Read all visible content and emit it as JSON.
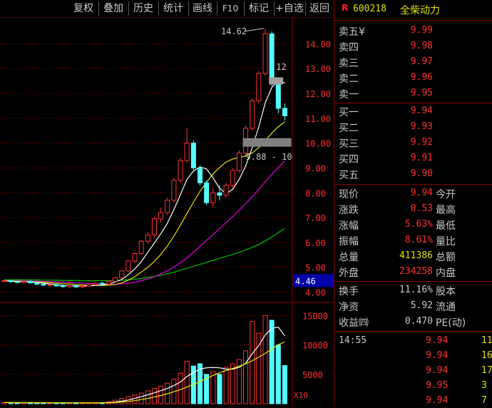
{
  "toolbar": {
    "buttons": [
      "复权",
      "叠加",
      "历史",
      "统计",
      "画线",
      "F10",
      "标记",
      "+自选",
      "返回"
    ]
  },
  "stock": {
    "badge": "R",
    "code": "600218",
    "name": "全柴动力"
  },
  "chart_data": {
    "type": "candlestick",
    "y_axis_labels": [
      "14.00",
      "13.00",
      "12.00",
      "11.00",
      "10.00",
      "9.00",
      "8.00",
      "7.00",
      "6.00",
      "5.00",
      "4.00"
    ],
    "y_range": [
      3.7,
      14.9
    ],
    "current_price_label": "4.46",
    "annotations": {
      "high_label": "14.62",
      "low_label": "9.88",
      "right_label_12": "12",
      "right_label_10": "10"
    },
    "candles": [
      {
        "o": 4.45,
        "h": 4.5,
        "l": 4.4,
        "c": 4.46
      },
      {
        "o": 4.46,
        "h": 4.5,
        "l": 4.38,
        "c": 4.42
      },
      {
        "o": 4.42,
        "h": 4.48,
        "l": 4.35,
        "c": 4.4
      },
      {
        "o": 4.4,
        "h": 4.46,
        "l": 4.34,
        "c": 4.43
      },
      {
        "o": 4.43,
        "h": 4.49,
        "l": 4.36,
        "c": 4.37
      },
      {
        "o": 4.37,
        "h": 4.42,
        "l": 4.28,
        "c": 4.32
      },
      {
        "o": 4.32,
        "h": 4.38,
        "l": 4.25,
        "c": 4.28
      },
      {
        "o": 4.28,
        "h": 4.35,
        "l": 4.2,
        "c": 4.3
      },
      {
        "o": 4.3,
        "h": 4.36,
        "l": 4.22,
        "c": 4.25
      },
      {
        "o": 4.25,
        "h": 4.3,
        "l": 4.18,
        "c": 4.22
      },
      {
        "o": 4.22,
        "h": 4.28,
        "l": 4.16,
        "c": 4.26
      },
      {
        "o": 4.26,
        "h": 4.32,
        "l": 4.18,
        "c": 4.21
      },
      {
        "o": 4.21,
        "h": 4.28,
        "l": 4.15,
        "c": 4.24
      },
      {
        "o": 4.24,
        "h": 4.33,
        "l": 4.2,
        "c": 4.3
      },
      {
        "o": 4.3,
        "h": 4.38,
        "l": 4.24,
        "c": 4.36
      },
      {
        "o": 4.36,
        "h": 4.42,
        "l": 4.28,
        "c": 4.33
      },
      {
        "o": 4.33,
        "h": 4.46,
        "l": 4.3,
        "c": 4.44
      },
      {
        "o": 4.44,
        "h": 4.6,
        "l": 4.4,
        "c": 4.58
      },
      {
        "o": 4.58,
        "h": 4.9,
        "l": 4.55,
        "c": 4.85
      },
      {
        "o": 4.85,
        "h": 5.3,
        "l": 4.82,
        "c": 5.25
      },
      {
        "o": 5.25,
        "h": 5.6,
        "l": 5.18,
        "c": 5.55
      },
      {
        "o": 5.55,
        "h": 6.1,
        "l": 5.5,
        "c": 6.05
      },
      {
        "o": 6.05,
        "h": 6.4,
        "l": 5.95,
        "c": 6.3
      },
      {
        "o": 6.3,
        "h": 7.0,
        "l": 6.2,
        "c": 6.95
      },
      {
        "o": 6.95,
        "h": 7.4,
        "l": 6.8,
        "c": 7.2
      },
      {
        "o": 7.2,
        "h": 7.8,
        "l": 7.1,
        "c": 7.7
      },
      {
        "o": 7.7,
        "h": 8.6,
        "l": 7.6,
        "c": 8.5
      },
      {
        "o": 8.5,
        "h": 9.4,
        "l": 8.4,
        "c": 9.3
      },
      {
        "o": 9.3,
        "h": 10.6,
        "l": 9.2,
        "c": 10.0
      },
      {
        "o": 10.0,
        "h": 10.1,
        "l": 8.9,
        "c": 9.0
      },
      {
        "o": 9.0,
        "h": 9.1,
        "l": 8.3,
        "c": 8.4
      },
      {
        "o": 8.4,
        "h": 8.5,
        "l": 7.5,
        "c": 7.6
      },
      {
        "o": 7.6,
        "h": 8.2,
        "l": 7.4,
        "c": 8.0
      },
      {
        "o": 8.0,
        "h": 8.3,
        "l": 7.7,
        "c": 7.9
      },
      {
        "o": 7.9,
        "h": 8.4,
        "l": 7.8,
        "c": 8.3
      },
      {
        "o": 8.3,
        "h": 9.0,
        "l": 8.2,
        "c": 8.9
      },
      {
        "o": 8.9,
        "h": 9.7,
        "l": 8.8,
        "c": 9.6
      },
      {
        "o": 9.6,
        "h": 10.7,
        "l": 9.5,
        "c": 10.6
      },
      {
        "o": 10.6,
        "h": 11.8,
        "l": 10.5,
        "c": 11.7
      },
      {
        "o": 11.7,
        "h": 12.9,
        "l": 11.6,
        "c": 12.8
      },
      {
        "o": 12.8,
        "h": 14.62,
        "l": 12.7,
        "c": 14.4
      },
      {
        "o": 14.4,
        "h": 14.5,
        "l": 12.3,
        "c": 12.4
      },
      {
        "o": 12.4,
        "h": 12.6,
        "l": 11.2,
        "c": 11.4
      },
      {
        "o": 11.4,
        "h": 11.6,
        "l": 10.9,
        "c": 11.1
      }
    ],
    "ma5": [
      4.46,
      4.44,
      4.43,
      4.42,
      4.42,
      4.39,
      4.36,
      4.33,
      4.3,
      4.27,
      4.26,
      4.25,
      4.24,
      4.25,
      4.27,
      4.29,
      4.33,
      4.41,
      4.51,
      4.7,
      4.93,
      5.23,
      5.6,
      5.98,
      6.35,
      6.78,
      7.32,
      7.93,
      8.54,
      8.88,
      9.04,
      8.96,
      8.6,
      8.18,
      7.96,
      8.14,
      8.54,
      9.08,
      9.82,
      10.65,
      11.62,
      12.24,
      12.54,
      12.42
    ],
    "ma10": [
      4.46,
      4.45,
      4.44,
      4.43,
      4.42,
      4.41,
      4.4,
      4.38,
      4.36,
      4.34,
      4.33,
      4.31,
      4.29,
      4.28,
      4.27,
      4.27,
      4.28,
      4.31,
      4.37,
      4.48,
      4.62,
      4.81,
      5.0,
      5.24,
      5.52,
      5.86,
      6.26,
      6.7,
      7.17,
      7.62,
      8.06,
      8.42,
      8.76,
      9.02,
      9.24,
      9.36,
      9.42,
      9.48,
      9.6,
      9.82,
      10.1,
      10.4,
      10.66,
      10.86
    ],
    "ma20": [
      4.46,
      4.46,
      4.45,
      4.45,
      4.44,
      4.44,
      4.43,
      4.42,
      4.41,
      4.4,
      4.39,
      4.38,
      4.36,
      4.35,
      4.34,
      4.33,
      4.32,
      4.32,
      4.33,
      4.36,
      4.4,
      4.46,
      4.53,
      4.62,
      4.73,
      4.86,
      5.01,
      5.18,
      5.38,
      5.6,
      5.84,
      6.08,
      6.32,
      6.56,
      6.8,
      7.04,
      7.3,
      7.56,
      7.84,
      8.14,
      8.44,
      8.74,
      9.02,
      9.28
    ],
    "ma60": [
      4.5,
      4.5,
      4.5,
      4.49,
      4.49,
      4.49,
      4.48,
      4.48,
      4.48,
      4.47,
      4.47,
      4.47,
      4.46,
      4.46,
      4.46,
      4.46,
      4.46,
      4.47,
      4.48,
      4.5,
      4.52,
      4.55,
      4.59,
      4.63,
      4.68,
      4.74,
      4.8,
      4.88,
      4.96,
      5.04,
      5.12,
      5.2,
      5.28,
      5.36,
      5.44,
      5.52,
      5.6,
      5.7,
      5.8,
      5.92,
      6.06,
      6.22,
      6.4,
      6.56
    ],
    "volume_axis_labels": [
      "15000",
      "10000",
      "5000"
    ],
    "volume_range": [
      0,
      16500
    ],
    "volume_unit_label": "X10",
    "volume": [
      200,
      180,
      150,
      170,
      190,
      160,
      150,
      140,
      150,
      130,
      140,
      150,
      160,
      170,
      160,
      180,
      300,
      600,
      900,
      1200,
      1500,
      1800,
      2200,
      2600,
      3000,
      3500,
      4200,
      5200,
      7200,
      6400,
      6800,
      5000,
      5500,
      5000,
      6200,
      6800,
      7500,
      9000,
      14000,
      12000,
      15000,
      14200,
      10000,
      6500
    ],
    "vol_ma5": [
      200,
      190,
      180,
      178,
      180,
      174,
      164,
      162,
      158,
      148,
      146,
      146,
      148,
      154,
      160,
      164,
      194,
      278,
      436,
      630,
      900,
      1200,
      1520,
      1860,
      2220,
      2620,
      3100,
      3700,
      4640,
      5300,
      5880,
      6120,
      6180,
      6100,
      5900,
      5860,
      6200,
      6900,
      8500,
      9900,
      11700,
      12840,
      13040,
      11540
    ],
    "vol_ma10": [
      200,
      195,
      190,
      186,
      184,
      180,
      176,
      172,
      168,
      164,
      160,
      158,
      156,
      156,
      156,
      156,
      170,
      210,
      290,
      390,
      520,
      700,
      900,
      1140,
      1400,
      1700,
      2040,
      2400,
      2840,
      3300,
      3780,
      4300,
      4820,
      5260,
      5640,
      6000,
      6380,
      6780,
      7300,
      7930,
      8550,
      9300,
      10040,
      10520
    ]
  },
  "quote": {
    "sell": [
      {
        "label": "卖五¥",
        "price": "9.99"
      },
      {
        "label": "卖四",
        "price": "9.98"
      },
      {
        "label": "卖三",
        "price": "9.97"
      },
      {
        "label": "卖二",
        "price": "9.96"
      },
      {
        "label": "卖一",
        "price": "9.95"
      }
    ],
    "buy": [
      {
        "label": "买一",
        "price": "9.94"
      },
      {
        "label": "买二",
        "price": "9.93"
      },
      {
        "label": "买三",
        "price": "9.92"
      },
      {
        "label": "买四",
        "price": "9.91"
      },
      {
        "label": "买五",
        "price": "9.90"
      }
    ],
    "stats": [
      {
        "label": "现价",
        "value": "9.94",
        "label2": "今开"
      },
      {
        "label": "涨跌",
        "value": "0.53",
        "label2": "最高"
      },
      {
        "label": "涨幅",
        "value": "5.63%",
        "label2": "最低"
      },
      {
        "label": "振幅",
        "value": "8.61%",
        "label2": "量比"
      },
      {
        "label": "总量",
        "value": "411386",
        "label2": "总额"
      },
      {
        "label": "外盘",
        "value": "234258",
        "label2": "内盘"
      }
    ],
    "fundamentals": [
      {
        "label": "换手",
        "value": "11.16%",
        "label2": "股本"
      },
      {
        "label": "净资",
        "value": "5.92",
        "label2": "流通"
      },
      {
        "label": "收益㈣",
        "value": "0.470",
        "label2": "PE(动)"
      }
    ],
    "ticks": [
      {
        "time": "14:55",
        "price": "9.94",
        "vol": "11"
      },
      {
        "time": "",
        "price": "9.94",
        "vol": "16"
      },
      {
        "time": "",
        "price": "9.94",
        "vol": "17"
      },
      {
        "time": "",
        "price": "9.95",
        "vol": "3"
      },
      {
        "time": "",
        "price": "9.94",
        "vol": "7"
      }
    ]
  },
  "colors": {
    "up": "#ff3232",
    "down": "#54ffff",
    "ma5": "#ffffff",
    "ma10": "#e6e600",
    "ma20": "#e000e0",
    "ma60": "#00c000",
    "grid": "#8a0000"
  }
}
